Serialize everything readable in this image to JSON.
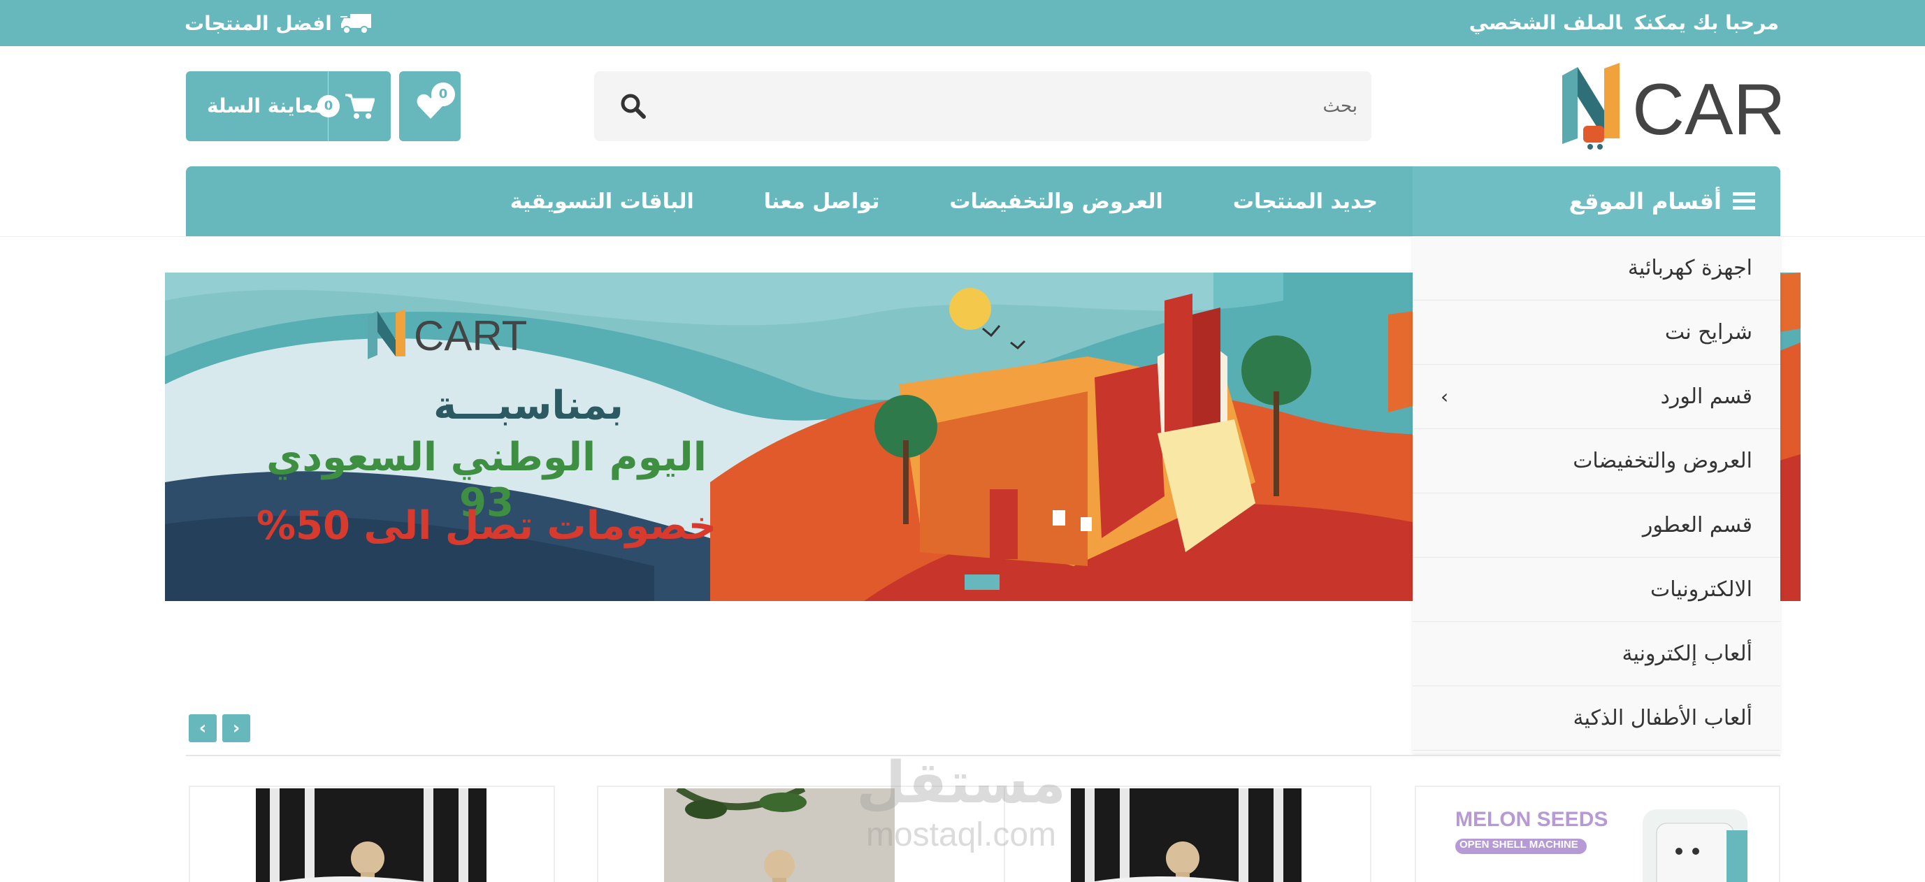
{
  "topbar": {
    "welcome": "مرحبا بك يمكنك",
    "profile": "الملف الشخصي",
    "best_products": "افضل المنتجات",
    "icon": "truck-icon"
  },
  "header": {
    "logo_text": "CART",
    "search_placeholder": "بحث",
    "cart_label": "معاينة السلة",
    "cart_count": "0",
    "wishlist_count": "0"
  },
  "nav": {
    "categories_label": "أقسام الموقع",
    "links": [
      "جديد المنتجات",
      "العروض والتخفيضات",
      "تواصل معنا",
      "الباقات التسويقية"
    ]
  },
  "categories": [
    {
      "label": "اجهزة كهربائية",
      "has_children": false
    },
    {
      "label": "شرايح نت",
      "has_children": false
    },
    {
      "label": "قسم الورد",
      "has_children": true
    },
    {
      "label": "العروض والتخفيضات",
      "has_children": false
    },
    {
      "label": "قسم العطور",
      "has_children": false
    },
    {
      "label": "الالكترونيات",
      "has_children": false
    },
    {
      "label": "ألعاب إلكترونية",
      "has_children": false
    },
    {
      "label": "ألعاب الأطفال الذكية",
      "has_children": false
    }
  ],
  "banner": {
    "brand": "CART",
    "line1": "بمناسبـــة",
    "line2": "اليوم الوطني السعودي 93",
    "line3": "خصومات تصل الى 50%"
  },
  "products": {
    "card4_title": "MELON SEEDS",
    "card4_sub": "OPEN SHELL MACHINE"
  },
  "watermark": {
    "ar": "مستقل",
    "en": "mostaql.com"
  },
  "colors": {
    "primary": "#66b8bd",
    "banner_red": "#d83a2e",
    "banner_green": "#3f8f43"
  }
}
